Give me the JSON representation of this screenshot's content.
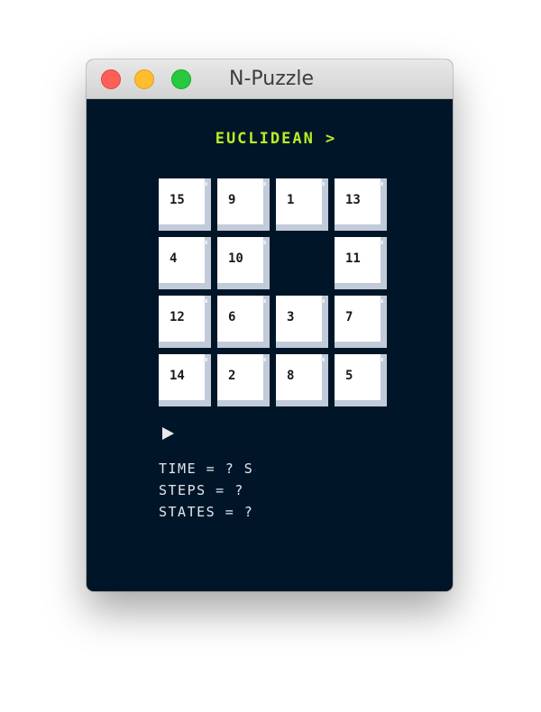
{
  "window": {
    "title": "N-Puzzle"
  },
  "colors": {
    "background": "#001628",
    "accent": "#b9ee26",
    "tile_face": "#ffffff",
    "tile_shadow": "#c2cbd9",
    "stats_text": "#e3e6ec"
  },
  "heuristic": {
    "label": "EUCLIDEAN >"
  },
  "board": {
    "size": 4,
    "tiles": [
      "15",
      "9",
      "1",
      "13",
      "4",
      "10",
      "",
      "11",
      "12",
      "6",
      "3",
      "7",
      "14",
      "2",
      "8",
      "5"
    ]
  },
  "controls": {
    "play_icon": "play-triangle"
  },
  "stats": {
    "time": "TIME = ? S",
    "steps": "STEPS = ?",
    "states": "STATES = ?"
  }
}
